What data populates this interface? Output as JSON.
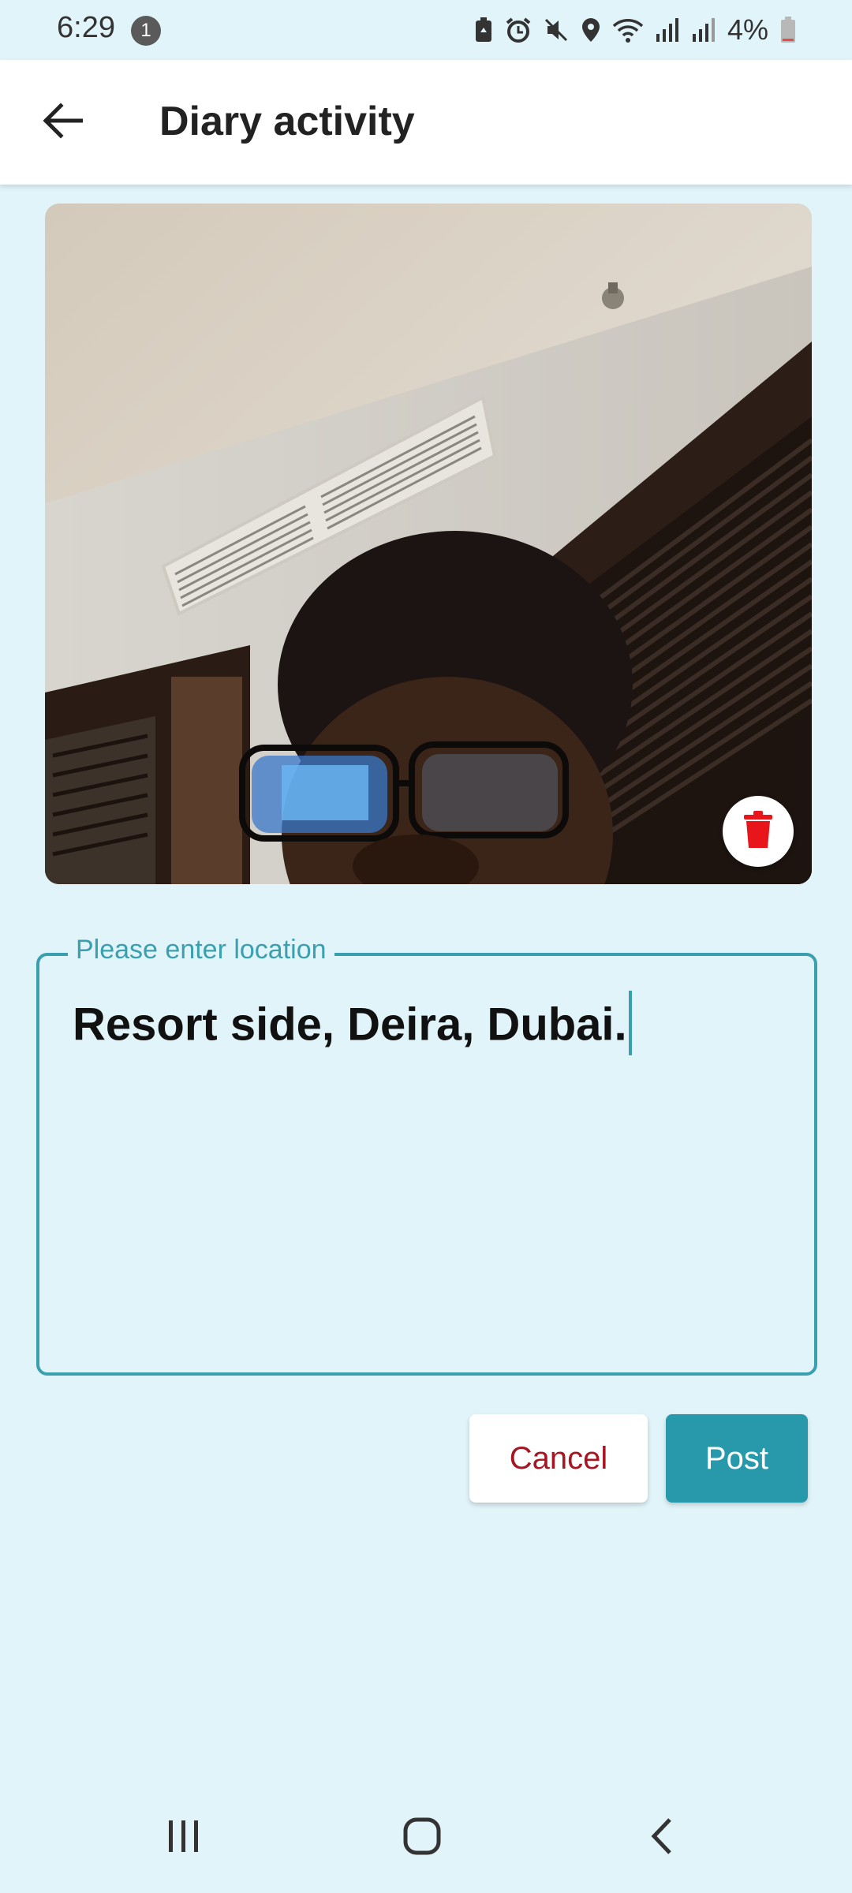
{
  "status_bar": {
    "time": "6:29",
    "notification_count": "1",
    "battery": "4%",
    "icons": [
      "battery-saver-icon",
      "alarm-icon",
      "mute-icon",
      "location-icon",
      "wifi-icon",
      "signal-icon",
      "signal-icon",
      "battery-icon"
    ]
  },
  "app_bar": {
    "title": "Diary activity",
    "back_icon": "arrow-left-icon"
  },
  "photo": {
    "delete_icon": "trash-icon",
    "delete_color": "#e8151b"
  },
  "location_field": {
    "label": "Please enter location",
    "value": "Resort side, Deira, Dubai."
  },
  "actions": {
    "cancel_label": "Cancel",
    "post_label": "Post"
  },
  "nav_bar": {
    "icons": [
      "recents-icon",
      "home-icon",
      "back-icon"
    ]
  },
  "colors": {
    "background": "#e1f4f9",
    "accent": "#3a9fae",
    "post_button": "#2899ab",
    "cancel_text": "#a51622"
  }
}
